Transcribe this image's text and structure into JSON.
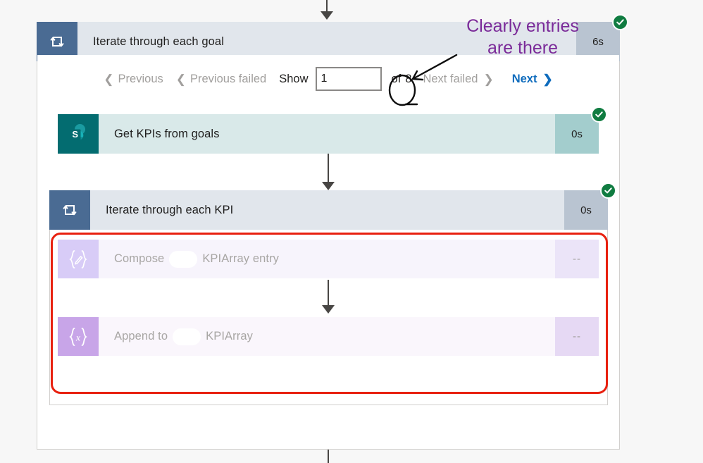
{
  "app": {
    "kind": "power-automate-run-history",
    "colors": {
      "loop_icon_bg": "#4a6b93",
      "loop_header_bg": "#e1e6ec",
      "sharepoint_teal": "#036c70",
      "success_green": "#107c41",
      "link_blue": "#0f6cbd",
      "annotation_purple": "#7b2b99",
      "annotation_red": "#e8200f",
      "compose_purple": "#d8ccf7",
      "append_purple": "#c8a5e8"
    }
  },
  "outer_loop": {
    "title": "Iterate through each goal",
    "icon": "loop-icon",
    "duration": "6s",
    "status": "succeeded",
    "status_icon": "check-circle-icon"
  },
  "pager": {
    "previous_label": "Previous",
    "previous_chevron": "❮",
    "previous_failed_label": "Previous failed",
    "previous_failed_chevron": "❮",
    "show_label": "Show",
    "show_value": "1",
    "show_placeholder": "1",
    "of_label": "of",
    "of_count": "8",
    "next_failed_label": "Next failed",
    "next_failed_chevron": "❯",
    "next_label": "Next",
    "next_chevron": "❯"
  },
  "actions": [
    {
      "name": "get-kpis-from-goals",
      "title": "Get KPIs from goals",
      "icon": "sharepoint-icon",
      "duration": "0s",
      "status": "succeeded",
      "status_icon": "check-circle-icon"
    }
  ],
  "inner_loop": {
    "title": "Iterate through each KPI",
    "icon": "loop-icon",
    "duration": "0s",
    "status": "succeeded",
    "status_icon": "check-circle-icon"
  },
  "inner_actions": [
    {
      "name": "compose-kpiarray-entry",
      "title_before": "Compose",
      "redacted": true,
      "title_after": "KPIArray entry",
      "icon": "compose-braces-pencil-icon",
      "duration": "--",
      "status": "skipped"
    },
    {
      "name": "append-to-kpiarray",
      "title_before": "Append to",
      "redacted": true,
      "title_after": "KPIArray",
      "icon": "variable-braces-x-icon",
      "duration": "--",
      "status": "skipped"
    }
  ],
  "annotations": {
    "callout_line1": "Clearly entries",
    "callout_line2": "are there",
    "callout_color": "#7b2b99",
    "circle_target": "8",
    "highlight_box_color": "#e8200f"
  }
}
